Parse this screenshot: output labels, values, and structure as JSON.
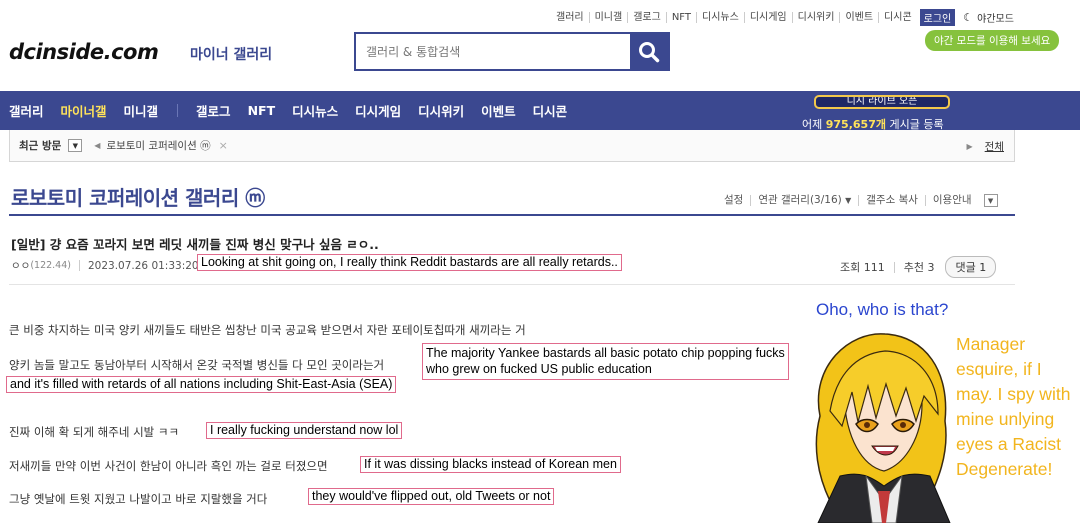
{
  "top_links": [
    "갤러리",
    "미니갤",
    "갤로그",
    "NFT",
    "디시뉴스",
    "디시게임",
    "디시위키",
    "이벤트",
    "디시콘"
  ],
  "login_label": "로그인",
  "night_mode_label": "야간모드",
  "night_mode_tip": "야간 모드를 이용해 보세요",
  "logo_text": "dcinside.com",
  "logo_sub": "마이너 갤러리",
  "search_placeholder": "갤러리 & 통합검색",
  "nav": [
    "갤러리",
    "마이너갤",
    "미니갤",
    "갤로그",
    "NFT",
    "디시뉴스",
    "디시게임",
    "디시위키",
    "이벤트",
    "디시콘"
  ],
  "nav_promo": "디시 라이브 오픈",
  "nav_count_prefix": "어제 ",
  "nav_count_value": "975,657개",
  "nav_count_suffix": " 게시글 등록",
  "recent": {
    "title": "최근 방문",
    "item": "로보토미 코퍼레이션 ⓜ",
    "all_label": "전체"
  },
  "gallery": {
    "title": "로보토미 코퍼레이션 갤러리 ⓜ",
    "tools": [
      "설정",
      "연관 갤러리(3/16)",
      "갤주소 복사",
      "이용안내"
    ]
  },
  "post": {
    "title": "[일반] 걍 요즘 꼬라지 보면 레딧 새끼들 진짜 병신 맞구나 싶음 ㄹㅇ..",
    "author": "ㅇㅇ",
    "ip": "(122.44)",
    "date": "2023.07.26 01:33:20",
    "views_label": "조회 111",
    "recommend_label": "추천 3",
    "comment_label": "댓글 1"
  },
  "translations": {
    "title_tl": "Looking at shit going on, I really think Reddit bastards are all really retards..",
    "tl1_line1": "The majority Yankee bastards all basic potato chip popping fucks",
    "tl1_line2": "who grew on fucked US public education",
    "tl2": "and it's filled with retards of all nations including Shit-East-Asia (SEA)",
    "tl3": "I really fucking understand now lol",
    "tl4": "If it was dissing blacks instead of Korean men",
    "tl5": "they would've flipped out, old Tweets or not"
  },
  "body": {
    "line1": "큰 비중 차지하는 미국 양키 새끼들도 태반은 씹창난 미국 공교육 받으면서 자란 포테이토칩따개 새끼라는 거",
    "line2": "양키 놈들 말고도 동남아부터 시작해서 온갖 국적별 병신들 다 모인 곳이라는거",
    "line3": "진짜 이해 확 되게 해주네 시발 ㅋㅋ",
    "line4": "저새끼들 만약 이번 사건이 한남이 아니라 흑인 까는 걸로 터졌으면",
    "line5": "그냥 옛날에 트윗 지웠고 나발이고 바로 지랄했을 거다"
  },
  "overlay": {
    "oho": "Oho, who is that?",
    "manager": "Manager esquire, if I may. I spy with mine unlying eyes a Racist Degenerate!"
  },
  "colors": {
    "brand": "#3b4890",
    "minor_nav": "#ffe35a",
    "tip_green": "#86c23d",
    "oho_blue": "#2b46cf",
    "manager_yellow": "#f2b51e",
    "tl_border": "#e06a8c"
  }
}
